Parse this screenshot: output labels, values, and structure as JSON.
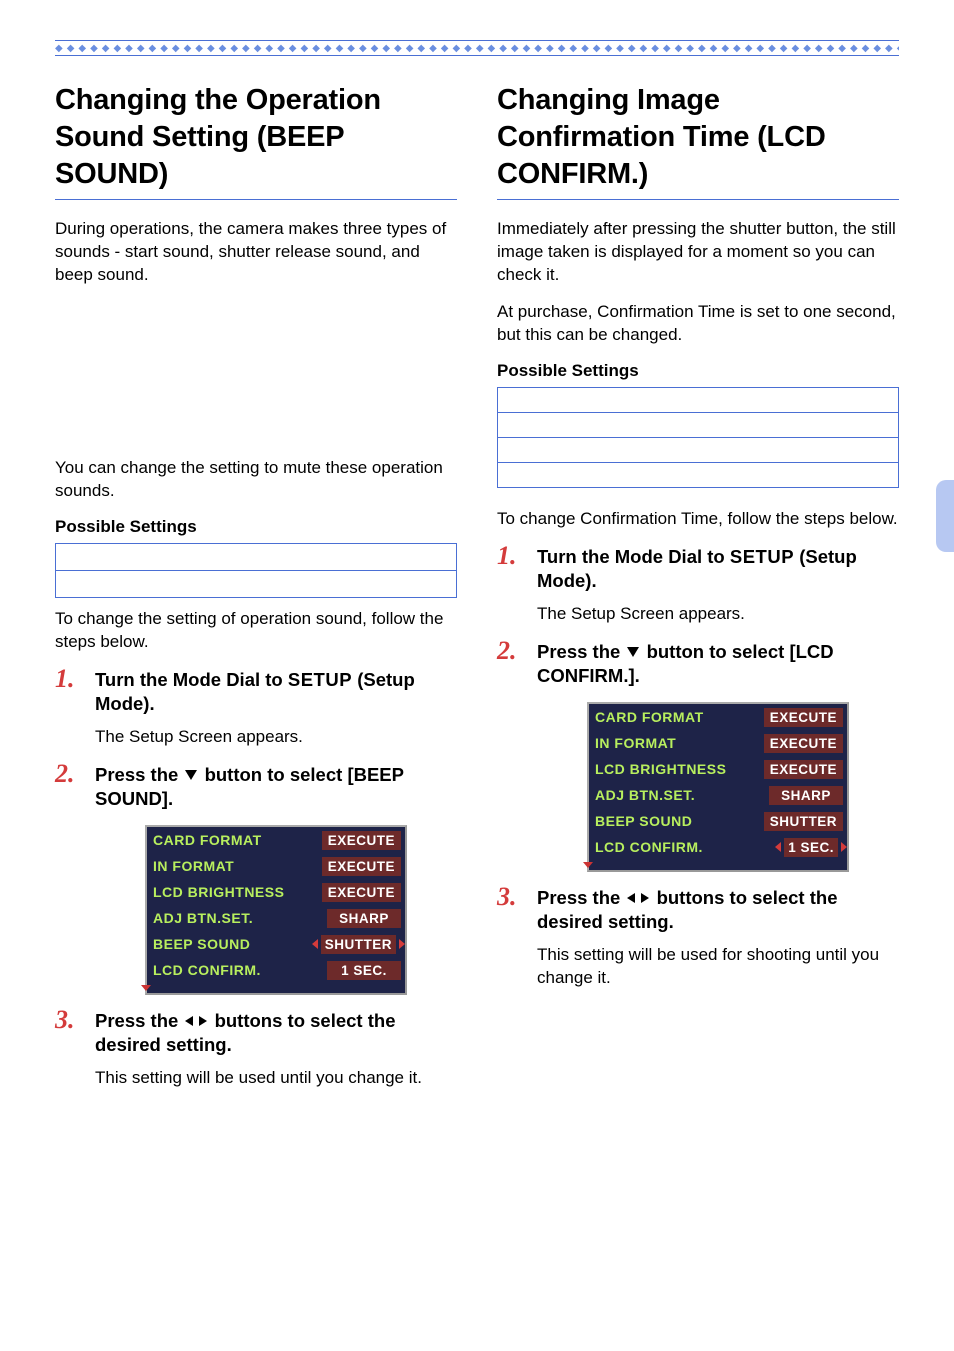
{
  "left": {
    "title": "Changing the Operation Sound Setting (BEEP SOUND)",
    "intro": "During operations, the camera makes three types of sounds - start sound, shutter release sound, and beep sound.",
    "note": "You can change the setting to mute these operation sounds.",
    "possible_label": "Possible Settings",
    "after_box": "To change the setting of operation sound, follow the steps below.",
    "steps": [
      {
        "main_pre": "Turn the Mode Dial to ",
        "main_setup": "SETUP",
        "main_post": " (Setup Mode).",
        "sub": "The Setup Screen appears."
      },
      {
        "main_pre": "Press the ",
        "main_post": " button to select [BEEP SOUND].",
        "icon": "down",
        "sub": ""
      },
      {
        "main_pre": "Press the ",
        "main_post": " buttons to select the desired setting.",
        "icon": "lr",
        "sub": "This setting will be used until you change it."
      }
    ],
    "lcd": {
      "rows": [
        {
          "label": "CARD FORMAT",
          "val": "EXECUTE"
        },
        {
          "label": "IN FORMAT",
          "val": "EXECUTE"
        },
        {
          "label": "LCD BRIGHTNESS",
          "val": "EXECUTE"
        },
        {
          "label": "ADJ BTN.SET.",
          "val": "SHARP"
        },
        {
          "label": "BEEP SOUND",
          "val": "SHUTTER",
          "selected": true
        },
        {
          "label": "LCD CONFIRM.",
          "val": "1 SEC."
        }
      ]
    }
  },
  "right": {
    "title": "Changing Image Confirmation Time (LCD CONFIRM.)",
    "intro1": "Immediately after pressing the shutter button, the still image taken is displayed for a moment so you can check it.",
    "intro2": "At purchase, Confirmation Time is set to one second, but this can be changed.",
    "possible_label": "Possible Settings",
    "after_box": "To change Confirmation Time, follow the steps below.",
    "steps": [
      {
        "main_pre": "Turn the Mode Dial to ",
        "main_setup": "SETUP",
        "main_post": " (Setup Mode).",
        "sub": "The Setup Screen appears."
      },
      {
        "main_pre": "Press the ",
        "main_post": "  button to select [LCD CONFIRM.].",
        "icon": "down",
        "sub": ""
      },
      {
        "main_pre": "Press the ",
        "main_post": " buttons to select the desired setting.",
        "icon": "lr",
        "sub": "This setting will be used for shooting until you change it."
      }
    ],
    "lcd": {
      "rows": [
        {
          "label": "CARD FORMAT",
          "val": "EXECUTE"
        },
        {
          "label": "IN FORMAT",
          "val": "EXECUTE"
        },
        {
          "label": "LCD BRIGHTNESS",
          "val": "EXECUTE"
        },
        {
          "label": "ADJ BTN.SET.",
          "val": "SHARP"
        },
        {
          "label": "BEEP SOUND",
          "val": "SHUTTER"
        },
        {
          "label": "LCD CONFIRM.",
          "val": "1 SEC.",
          "selected": true
        }
      ]
    }
  }
}
